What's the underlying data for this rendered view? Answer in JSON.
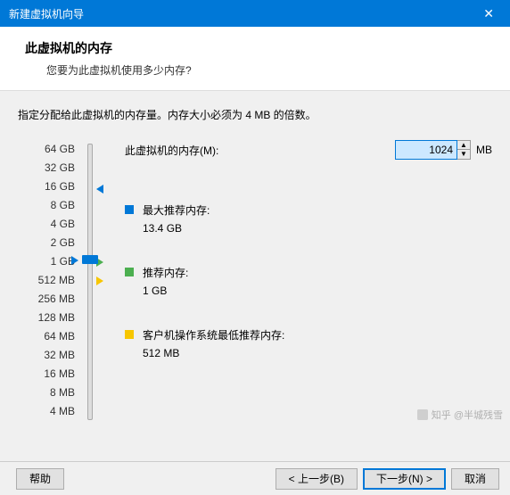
{
  "window": {
    "title": "新建虚拟机向导",
    "close": "✕"
  },
  "header": {
    "title": "此虚拟机的内存",
    "subtitle": "您要为此虚拟机使用多少内存?"
  },
  "instruction": "指定分配给此虚拟机的内存量。内存大小必须为 4 MB 的倍数。",
  "memory": {
    "label": "此虚拟机的内存(M):",
    "value": "1024",
    "unit": "MB"
  },
  "scale": [
    "64 GB",
    "32 GB",
    "16 GB",
    "8 GB",
    "4 GB",
    "2 GB",
    "1 GB",
    "512 MB",
    "256 MB",
    "128 MB",
    "64 MB",
    "32 MB",
    "16 MB",
    "8 MB",
    "4 MB"
  ],
  "legend": {
    "max": {
      "label": "最大推荐内存:",
      "value": "13.4 GB"
    },
    "rec": {
      "label": "推荐内存:",
      "value": "1 GB"
    },
    "min": {
      "label": "客户机操作系统最低推荐内存:",
      "value": "512 MB"
    }
  },
  "buttons": {
    "help": "帮助",
    "back": "< 上一步(B)",
    "next": "下一步(N) >",
    "cancel": "取消"
  },
  "watermark": "知乎 @半城残雪"
}
